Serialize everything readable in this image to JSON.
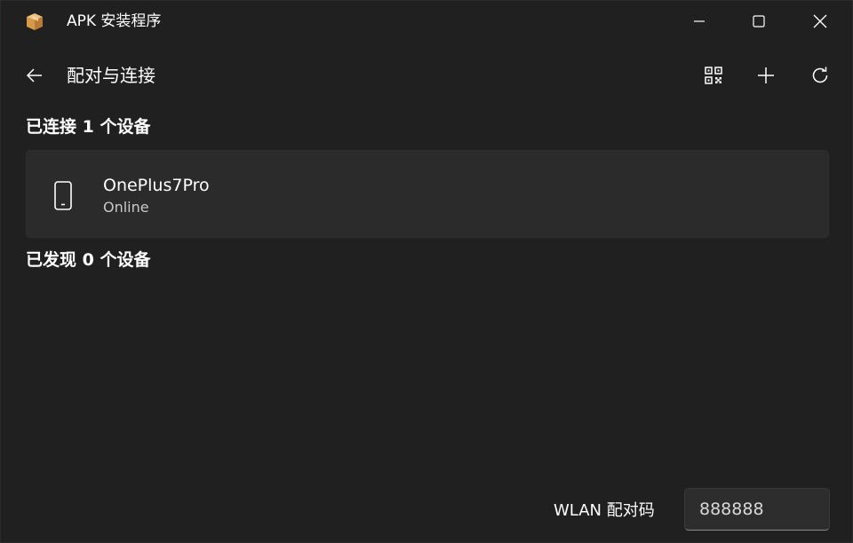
{
  "window": {
    "title": "APK 安装程序",
    "icon": "package-box-icon"
  },
  "header": {
    "title": "配对与连接",
    "actions": [
      "qr-code-icon",
      "plus-icon",
      "refresh-icon"
    ]
  },
  "connected": {
    "heading": "已连接 1 个设备",
    "devices": [
      {
        "name": "OnePlus7Pro",
        "status": "Online",
        "icon": "phone-icon"
      }
    ]
  },
  "discovered": {
    "heading": "已发现 0 个设备"
  },
  "footer": {
    "wlan_label": "WLAN 配对码",
    "wlan_code": "888888"
  },
  "colors": {
    "background": "#202020",
    "card": "#2b2b2b",
    "text": "#ffffff",
    "secondary_text": "#c8c8c8"
  }
}
